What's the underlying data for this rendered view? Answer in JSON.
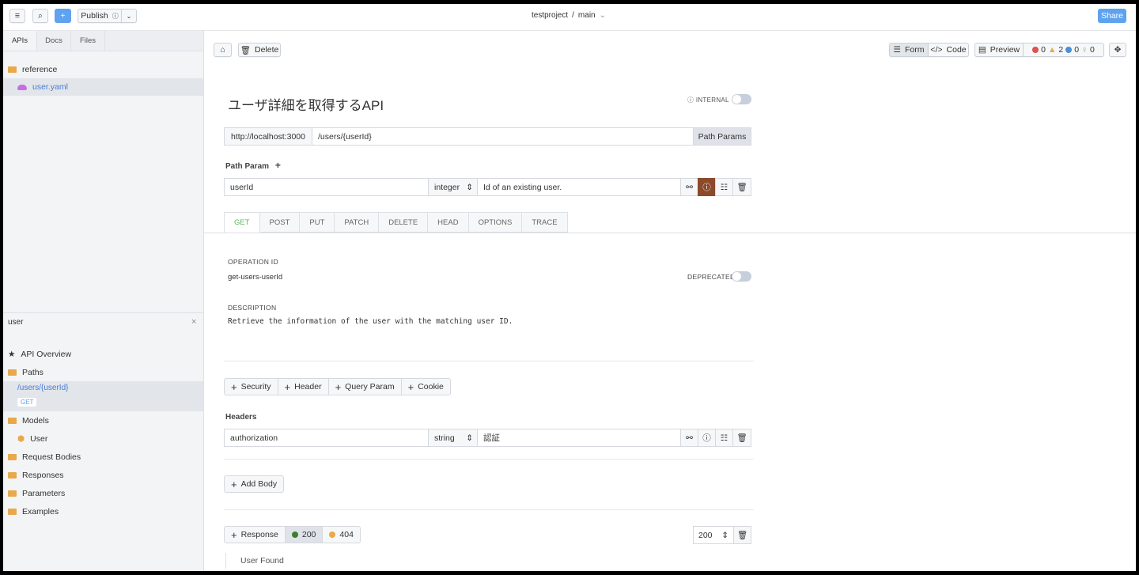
{
  "topbar": {
    "publish": "Publish",
    "project": "testproject",
    "separator": "/",
    "branch": "main",
    "share": "Share"
  },
  "sidebar": {
    "tabs": [
      "APIs",
      "Docs",
      "Files"
    ],
    "folder": "reference",
    "file": "user.yaml",
    "filter": "user",
    "tree": {
      "overview": "API Overview",
      "paths": "Paths",
      "path": "/users/{userId}",
      "method": "GET",
      "models": "Models",
      "model": "User",
      "request_bodies": "Request Bodies",
      "responses": "Responses",
      "parameters": "Parameters",
      "examples": "Examples"
    }
  },
  "toolbar": {
    "delete": "Delete",
    "form": "Form",
    "code": "Code",
    "preview": "Preview",
    "errors": "0",
    "warnings": "2",
    "infos": "0",
    "hints": "0"
  },
  "api": {
    "title": "ユーザ詳細を取得するAPI",
    "internal": "INTERNAL",
    "server": "http://localhost:3000",
    "path": "/users/{userId}",
    "path_params_btn": "Path Params",
    "path_param_label": "Path Param",
    "param": {
      "name": "userId",
      "type": "integer",
      "description": "Id of an existing user."
    },
    "methods": [
      "GET",
      "POST",
      "PUT",
      "PATCH",
      "DELETE",
      "HEAD",
      "OPTIONS",
      "TRACE"
    ],
    "operation_id_label": "OPERATION ID",
    "operation_id": "get-users-userId",
    "deprecated": "DEPRECATED",
    "description_label": "DESCRIPTION",
    "description": "Retrieve the information of the user with the matching user ID.",
    "add_buttons": [
      "Security",
      "Header",
      "Query Param",
      "Cookie"
    ],
    "headers_label": "Headers",
    "header": {
      "name": "authorization",
      "type": "string",
      "description": "認証"
    },
    "add_body": "Add Body",
    "response_btn": "Response",
    "responses": [
      {
        "code": "200",
        "color": "#3e7d2c"
      },
      {
        "code": "404",
        "color": "#e9a84a"
      }
    ],
    "selected_code": "200",
    "response_desc": "User Found"
  }
}
